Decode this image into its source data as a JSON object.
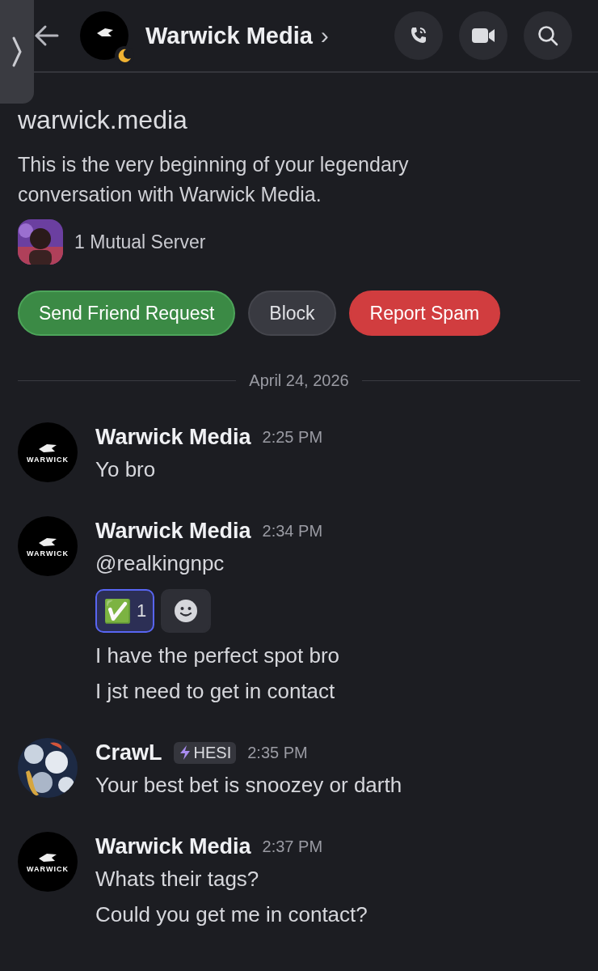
{
  "header": {
    "title": "Warwick Media",
    "chevron": "›",
    "status": {
      "kind": "idle"
    }
  },
  "profile": {
    "username": "warwick.media",
    "intro": "This is the very beginning of your legendary conversation with Warwick Media.",
    "mutual": "1 Mutual Server"
  },
  "actions": [
    {
      "label": "Send Friend Request",
      "kind": "primary"
    },
    {
      "label": "Block",
      "kind": "secondary"
    },
    {
      "label": "Report Spam",
      "kind": "danger"
    }
  ],
  "date_divider": "April 24, 2026",
  "messages": [
    {
      "author": "Warwick Media",
      "time": "2:25 PM",
      "avatar": {
        "kind": "logo",
        "text": "WARWICK"
      },
      "lines": [
        "Yo bro"
      ]
    },
    {
      "author": "Warwick Media",
      "time": "2:34 PM",
      "avatar": {
        "kind": "logo",
        "text": "WARWICK"
      },
      "lines": [
        "@realkingnpc"
      ],
      "reactions": [
        {
          "emoji": "✅",
          "count": "1",
          "selected": true
        }
      ],
      "more_lines": [
        "I have the perfect spot bro",
        "I jst need to get in contact"
      ]
    },
    {
      "author": "CrawL",
      "time": "2:35 PM",
      "avatar": {
        "kind": "picture"
      },
      "badge": "HESI",
      "lines": [
        "Your best bet is snoozey or darth"
      ]
    },
    {
      "author": "Warwick Media",
      "time": "2:37 PM",
      "avatar": {
        "kind": "logo",
        "text": "WARWICK"
      },
      "lines": [
        "Whats their tags?",
        "Could you get me in contact?"
      ]
    }
  ]
}
